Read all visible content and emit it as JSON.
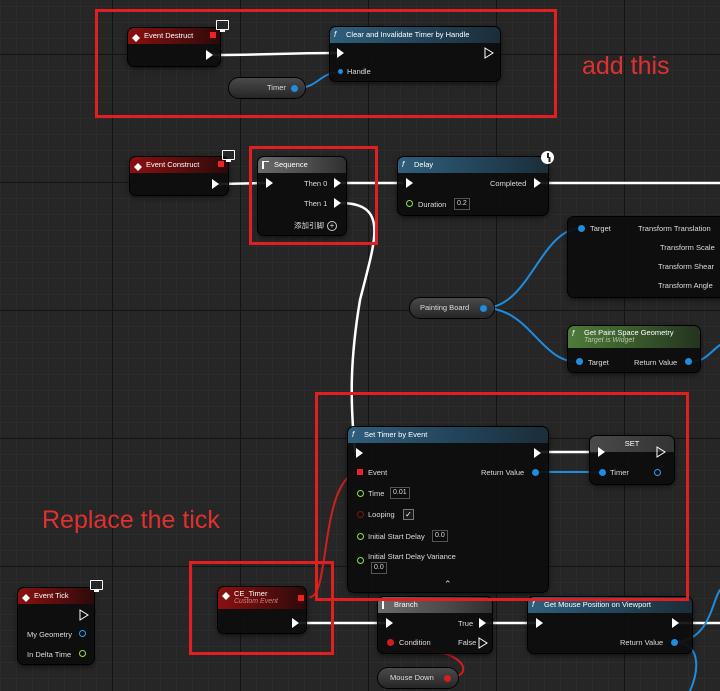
{
  "annotations": {
    "add_this": "add this",
    "replace_the_tick": "Replace the tick"
  },
  "nodes": {
    "event_destruct": {
      "title": "Event Destruct"
    },
    "clear_timer": {
      "title": "Clear and Invalidate Timer by Handle",
      "handle_label": "Handle"
    },
    "timer_var_top": {
      "label": "Timer"
    },
    "event_construct": {
      "title": "Event Construct"
    },
    "sequence": {
      "title": "Sequence",
      "then0": "Then 0",
      "then1": "Then 1",
      "add_pin": "添加引脚"
    },
    "delay": {
      "title": "Delay",
      "completed": "Completed",
      "duration_label": "Duration",
      "duration_value": "0.2"
    },
    "transform": {
      "target": "Target",
      "translation": "Transform Translation",
      "scale": "Transform Scale",
      "shear": "Transform Shear",
      "angle": "Transform Angle"
    },
    "painting_board": {
      "label": "Painting Board"
    },
    "get_paint_space": {
      "title": "Get Paint Space Geometry",
      "subtitle": "Target is Widget",
      "target": "Target",
      "return_value": "Return Value"
    },
    "set_timer": {
      "title": "Set Timer by Event",
      "event": "Event",
      "return_value": "Return Value",
      "time_label": "Time",
      "time_value": "0.01",
      "looping_label": "Looping",
      "looping_checked": "✓",
      "initial_delay_label": "Initial Start Delay",
      "initial_delay_value": "0.0",
      "variance_label": "Initial Start Delay Variance",
      "variance_value": "0.0",
      "expand": "⌃"
    },
    "set_node": {
      "title": "SET",
      "timer": "Timer"
    },
    "event_tick": {
      "title": "Event Tick",
      "my_geometry": "My Geometry",
      "in_delta_time": "In Delta Time"
    },
    "ce_timer": {
      "title": "CE_Timer",
      "subtitle": "Custom Event"
    },
    "branch": {
      "title": "Branch",
      "true_label": "True",
      "false_label": "False",
      "condition": "Condition"
    },
    "get_mouse_pos": {
      "title": "Get Mouse Position on Viewport",
      "return_value": "Return Value"
    },
    "mouse_down": {
      "label": "Mouse Down"
    }
  },
  "colors": {
    "exec": "#ffffff",
    "object": "#1e8de0",
    "float": "#8be24c",
    "bool": "#d21e1e",
    "annotation": "#e02020"
  },
  "icons": {
    "event": "event-diamond-icon",
    "function": "function-f-icon",
    "sequence": "sequence-icon",
    "latent": "clock-icon",
    "replicated": "monitor-icon"
  }
}
